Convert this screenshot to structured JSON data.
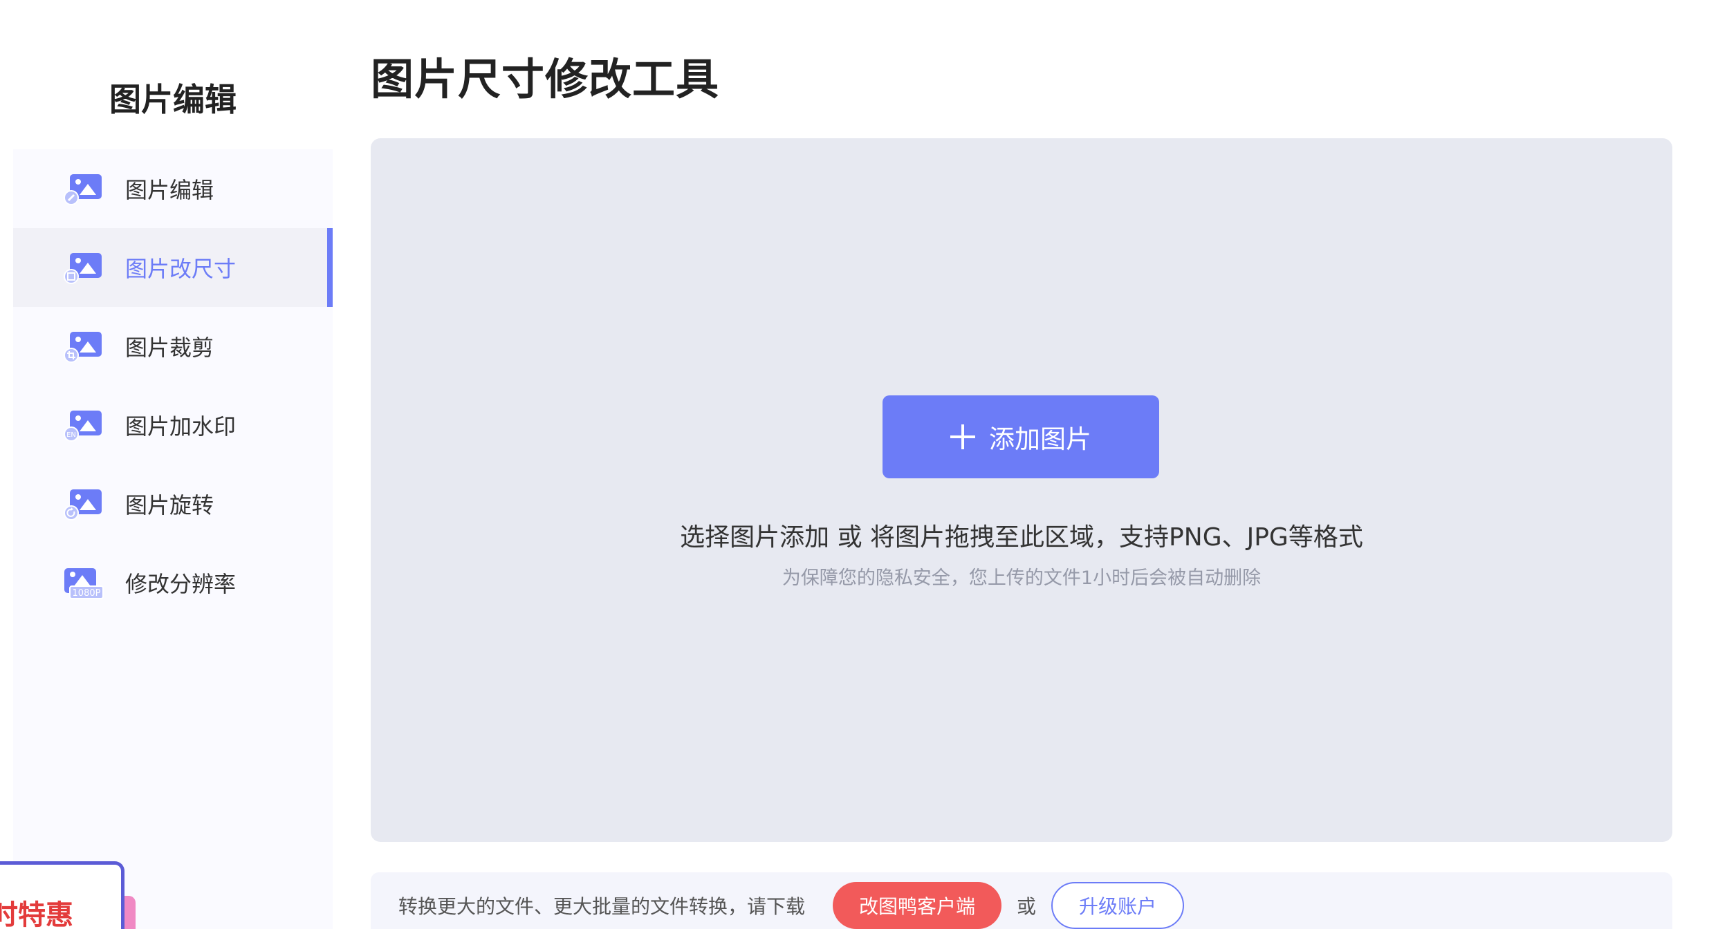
{
  "sidebar": {
    "title": "图片编辑",
    "items": [
      {
        "label": "图片编辑",
        "icon": "image-edit-icon",
        "active": false
      },
      {
        "label": "图片改尺寸",
        "icon": "image-resize-icon",
        "active": true
      },
      {
        "label": "图片裁剪",
        "icon": "image-crop-icon",
        "active": false
      },
      {
        "label": "图片加水印",
        "icon": "image-watermark-icon",
        "active": false
      },
      {
        "label": "图片旋转",
        "icon": "image-rotate-icon",
        "active": false
      },
      {
        "label": "修改分辨率",
        "icon": "image-resolution-icon",
        "active": false
      }
    ],
    "resolution_badge": "1080P",
    "watermark_badge": "EN",
    "promo_text": "时特惠"
  },
  "main": {
    "title": "图片尺寸修改工具",
    "upload": {
      "button_label": "添加图片",
      "hint": "选择图片添加 或 将图片拖拽至此区域，支持PNG、JPG等格式",
      "privacy": "为保障您的隐私安全，您上传的文件1小时后会被自动删除"
    },
    "bottom_bar": {
      "text": "转换更大的文件、更大批量的文件转换，请下载",
      "client_button": "改图鸭客户端",
      "or": "或",
      "upgrade_button": "升级账户"
    }
  },
  "colors": {
    "accent": "#6c7cf7",
    "danger": "#f25a5a",
    "upload_bg": "#e7e9f1"
  }
}
